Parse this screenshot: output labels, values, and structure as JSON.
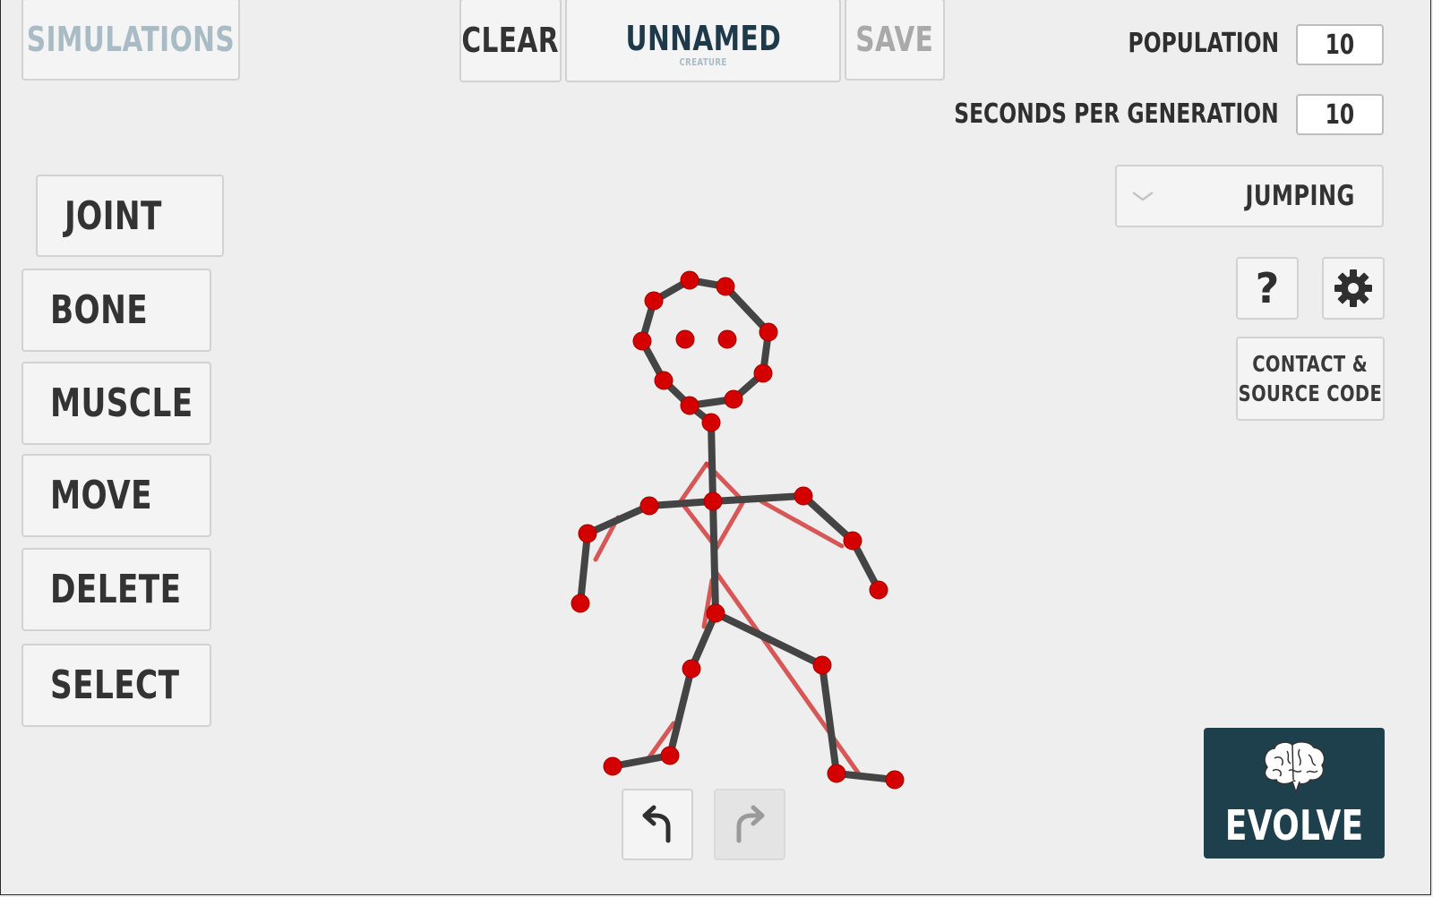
{
  "toolbar": {
    "simulations_label": "SIMULATIONS",
    "clear_label": "CLEAR",
    "creature_name": "UNNAMED",
    "creature_caption": "CREATURE",
    "save_label": "SAVE"
  },
  "tools": [
    {
      "label": "JOINT"
    },
    {
      "label": "BONE"
    },
    {
      "label": "MUSCLE"
    },
    {
      "label": "MOVE"
    },
    {
      "label": "DELETE"
    },
    {
      "label": "SELECT"
    }
  ],
  "settings": {
    "population_label": "POPULATION",
    "population_value": "10",
    "seconds_label": "SECONDS PER GENERATION",
    "seconds_value": "10",
    "task_selected": "JUMPING",
    "help_label": "?",
    "contact_label_line1": "CONTACT &",
    "contact_label_line2": "SOURCE CODE"
  },
  "evolve": {
    "label": "EVOLVE",
    "color": "#1e404d"
  },
  "icons": [
    "chevron-down-icon",
    "gear-icon",
    "brain-icon",
    "undo-icon",
    "redo-icon"
  ],
  "colors": {
    "joint": "#d40000",
    "bone": "#444444",
    "muscle": "#d23b3b",
    "disabled_text": "#a9bcc5",
    "title_text": "#1e3a4a"
  }
}
